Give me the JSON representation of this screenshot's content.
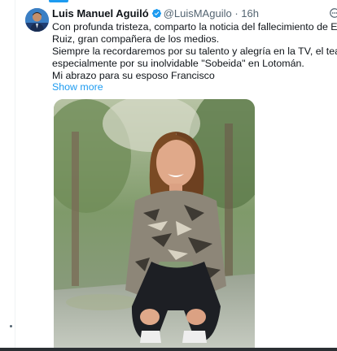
{
  "tweet": {
    "display_name": "Luis Manuel Aguiló",
    "handle": "@LuisMAguilo",
    "separator": "·",
    "time": "16h",
    "lines": [
      "Con profunda tristeza, comparto la noticia del fallecimiento de Elizabeth",
      "Ruiz, gran compañera de los medios.",
      "Siempre la recordaremos por su talento y alegría en la TV, el teatro y el cine,",
      "especialmente por su inolvidable \"Sobeida\" en Lotomán.",
      "Mi abrazo para su esposo Francisco"
    ],
    "show_more": "Show more"
  },
  "icons": {
    "verified": "verified-badge-icon",
    "more": "more-options-icon"
  },
  "colors": {
    "accent": "#1d9bf0",
    "secondary_text": "#536471",
    "primary_text": "#0f1419"
  }
}
